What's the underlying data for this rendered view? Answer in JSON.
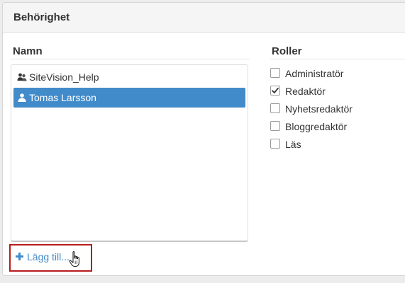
{
  "panel": {
    "title": "Behörighet"
  },
  "names": {
    "heading": "Namn",
    "items": [
      {
        "label": "SiteVision_Help",
        "icon": "user-group-icon",
        "selected": false
      },
      {
        "label": "Tomas Larsson",
        "icon": "user-icon",
        "selected": true
      }
    ],
    "add_label": "Lägg till..."
  },
  "roles": {
    "heading": "Roller",
    "items": [
      {
        "label": "Administratör",
        "checked": false
      },
      {
        "label": "Redaktör",
        "checked": true
      },
      {
        "label": "Nyhetsredaktör",
        "checked": false
      },
      {
        "label": "Bloggredaktör",
        "checked": false
      },
      {
        "label": "Läs",
        "checked": false
      }
    ]
  },
  "colors": {
    "selection": "#428bca",
    "link": "#428bca",
    "highlight_box": "#b71c1c"
  }
}
